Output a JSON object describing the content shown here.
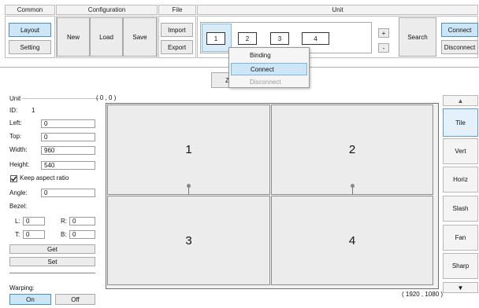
{
  "ribbon": {
    "groups": {
      "common": "Common",
      "configuration": "Configuration",
      "file": "File",
      "unit": "Unit"
    },
    "common": {
      "layout": "Layout",
      "setting": "Setting"
    },
    "configuration": {
      "new": "New",
      "load": "Load",
      "save": "Save"
    },
    "file": {
      "import": "Import",
      "export": "Export"
    },
    "unit": {
      "units": [
        "1",
        "2",
        "3",
        "4"
      ],
      "plus": "+",
      "minus": "-",
      "search": "Search",
      "connect": "Connect",
      "disconnect": "Disconnect"
    }
  },
  "context_menu": {
    "binding": "Binding",
    "connect": "Connect",
    "disconnect": "Disconnect"
  },
  "zoom_label": "Z",
  "unit_panel": {
    "title": "Unit",
    "id_label": "ID:",
    "id_value": "1",
    "left_label": "Left:",
    "left_value": "0",
    "top_label": "Top:",
    "top_value": "0",
    "width_label": "Width:",
    "width_value": "960",
    "height_label": "Height:",
    "height_value": "540",
    "keep_aspect_label": "Keep aspect ratio",
    "keep_aspect_checked": true,
    "angle_label": "Angle:",
    "angle_value": "0",
    "bezel_label": "Bezel:",
    "bezel_l_label": "L:",
    "bezel_l_value": "0",
    "bezel_r_label": "R:",
    "bezel_r_value": "0",
    "bezel_t_label": "T:",
    "bezel_t_value": "0",
    "bezel_b_label": "B:",
    "bezel_b_value": "0",
    "get": "Get",
    "set": "Set",
    "warping_label": "Warping:",
    "on": "On",
    "off": "Off"
  },
  "canvas": {
    "origin_label": "( 0 , 0 )",
    "end_label": "( 1920 , 1080 )",
    "cells": [
      "1",
      "2",
      "3",
      "4"
    ]
  },
  "right_panel": {
    "up": "▲",
    "tile": "Tile",
    "vert": "Vert",
    "horiz": "Horiz",
    "slash": "Slash",
    "fan": "Fan",
    "sharp": "Sharp",
    "down": "▼"
  },
  "colors": {
    "accent": "#cde6f7",
    "accent_border": "#4a90c8",
    "menu_highlight": "#cde6f7"
  }
}
